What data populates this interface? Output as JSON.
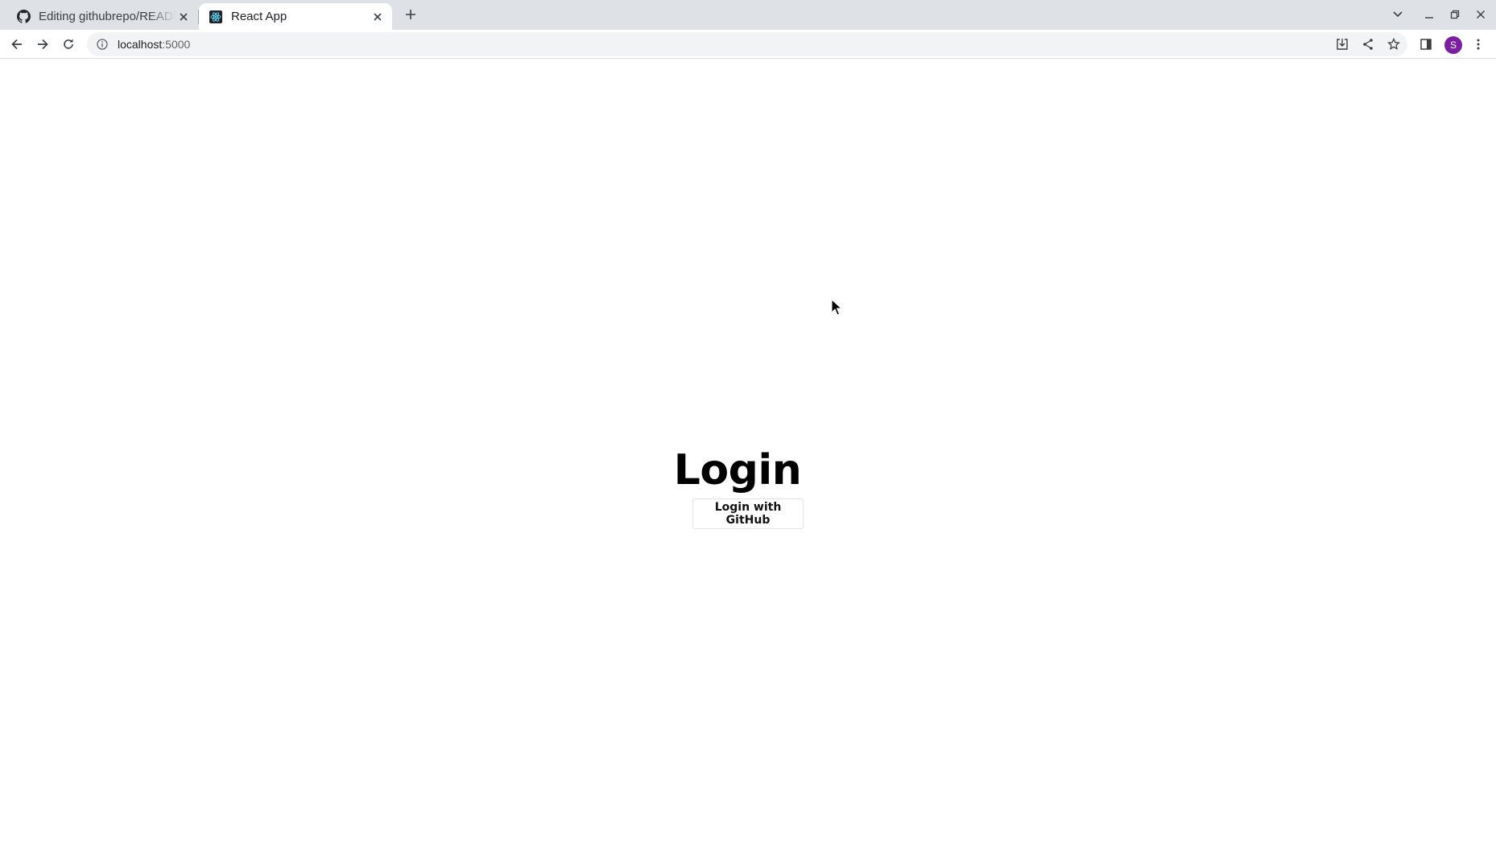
{
  "browser": {
    "tabs": [
      {
        "label": "Editing githubrepo/README.md",
        "icon": "github-icon",
        "active": false
      },
      {
        "label": "React App",
        "icon": "react-icon",
        "active": true
      }
    ],
    "address": {
      "host": "localhost",
      "port": ":5000"
    },
    "profile_initial": "S",
    "profile_color": "#7b1fa2"
  },
  "page": {
    "title": "Login",
    "login_button": "Login with GitHub"
  }
}
